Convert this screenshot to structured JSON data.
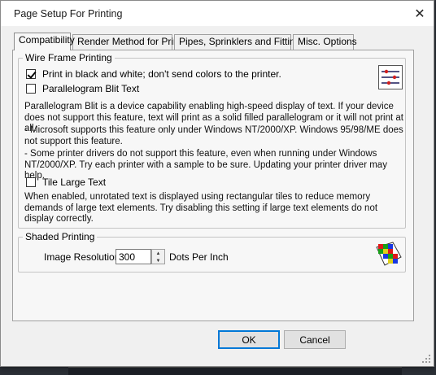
{
  "window": {
    "title": "Page Setup For Printing",
    "close_glyph": "✕"
  },
  "tabs": [
    {
      "label": "Compatibility",
      "active": true
    },
    {
      "label": "Render Method for Print",
      "active": false
    },
    {
      "label": "Pipes, Sprinklers and Fittings",
      "active": false
    },
    {
      "label": "Misc. Options",
      "active": false
    }
  ],
  "wireframe": {
    "legend": "Wire Frame Printing",
    "icon": "wireframe-settings-icon",
    "print_bw": {
      "label": "Print in black and white; don't send colors to the printer.",
      "checked": true
    },
    "parallelogram": {
      "label": "Parallelogram Blit Text",
      "checked": false
    },
    "desc1": "Parallelogram Blit is a device capability enabling high-speed display of text. If your device does not support this feature, text will print as a solid filled parallelogram or it will not print at all.",
    "desc2": " - Microsoft supports this feature only under Windows NT/2000/XP. Windows 95/98/ME does not support this feature.",
    "desc3": " - Some printer drivers do not support this feature, even when running under Windows NT/2000/XP. Try each printer with a sample to be sure. Updating your printer driver may help.",
    "tile_large": {
      "label": "Tile Large Text",
      "checked": false
    },
    "desc4": "When enabled, unrotated text is displayed using rectangular tiles to reduce memory demands of large text elements.  Try disabling this setting if large text elements do not display correctly."
  },
  "shaded": {
    "legend": "Shaded Printing",
    "icon": "color-grid-icon",
    "resolution_label": "Image Resolution",
    "resolution_value": "300",
    "resolution_unit": "Dots Per Inch"
  },
  "buttons": {
    "ok": "OK",
    "cancel": "Cancel"
  },
  "colors": {
    "accent": "#0078d7",
    "dialog_bg": "#f0f0f0",
    "panel_bg": "#f7f7f7"
  }
}
